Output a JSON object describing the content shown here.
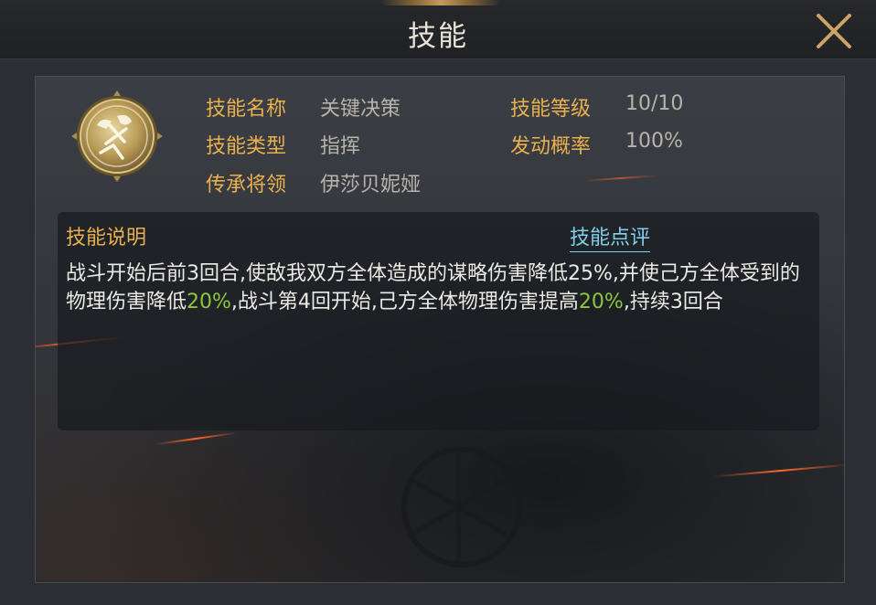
{
  "header": {
    "title": "技能",
    "close_icon": "close-x-icon"
  },
  "skill": {
    "icon": "skill-emblem-icon",
    "name_label": "技能名称",
    "name_value": "关键决策",
    "type_label": "技能类型",
    "type_value": "指挥",
    "inherit_label": "传承将领",
    "inherit_value": "伊莎贝妮娅",
    "level_label": "技能等级",
    "level_value": "10/10",
    "chance_label": "发动概率",
    "chance_value": "100%"
  },
  "description": {
    "title": "技能说明",
    "review_link": "技能点评",
    "part1": "战斗开始后前3回合,使敌我双方全体造成的谋略伤害降低25%,并使己方全体受到的物理伤害降低",
    "highlight1": "20%",
    "part2": ",战斗第4回开始,己方全体物理伤害提高",
    "highlight2": "20%",
    "part3": ",持续3回合"
  },
  "colors": {
    "label": "#e9b14e",
    "value": "#b7b3ab",
    "highlight": "#8dc63f",
    "link": "#7fd0e8",
    "title": "#e9e4da"
  }
}
